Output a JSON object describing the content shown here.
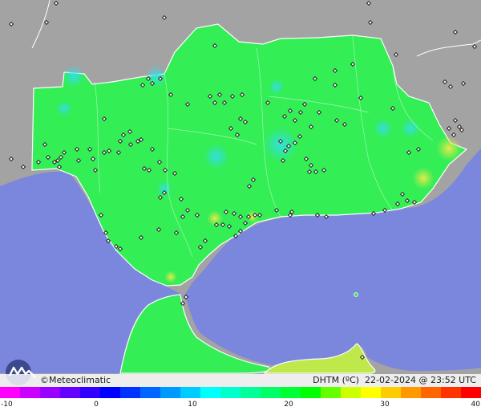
{
  "brand": {
    "copyright_symbol": "©",
    "name": "Meteoclimatic"
  },
  "map_info": {
    "variable": "DHTM (ºC)",
    "date": "22-02-2024",
    "at": "@",
    "time": "23:52 UTC"
  },
  "legend": {
    "ticks": [
      "-10",
      "0",
      "10",
      "20",
      "30",
      "40"
    ],
    "range": [
      -10,
      40
    ],
    "colors": [
      "#ff00ff",
      "#cc00ff",
      "#9900ff",
      "#6600ff",
      "#3300ff",
      "#0000ff",
      "#0033ff",
      "#0066ff",
      "#0099ff",
      "#00ccff",
      "#00ffff",
      "#00ffcc",
      "#00ff99",
      "#00ff66",
      "#00ff33",
      "#00ff00",
      "#66ff00",
      "#ccff00",
      "#ffff00",
      "#ffcc00",
      "#ff9900",
      "#ff6600",
      "#ff3300",
      "#ff0000"
    ]
  },
  "colors": {
    "sea": "#7b86dd",
    "land_grey": "#a3a3a3",
    "region_green": "#33ee55"
  }
}
